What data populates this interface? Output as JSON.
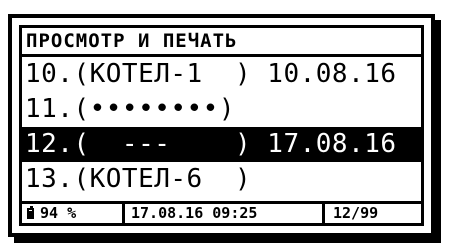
{
  "header": {
    "title": "ПРОСМОТР И ПЕЧАТЬ"
  },
  "records": [
    {
      "text": "10.(КОТЕЛ-1  ) 10.08.16",
      "selected": false
    },
    {
      "text": "11.(••••••••)",
      "selected": false
    },
    {
      "text": "12.(  ---    ) 17.08.16",
      "selected": true
    },
    {
      "text": "13.(КОТЕЛ-6  )",
      "selected": false
    }
  ],
  "status": {
    "battery": "94 %",
    "battery_level": 0.94,
    "datetime": "17.08.16 09:25",
    "page": "12/99"
  },
  "icons": {
    "battery": "battery-icon"
  }
}
